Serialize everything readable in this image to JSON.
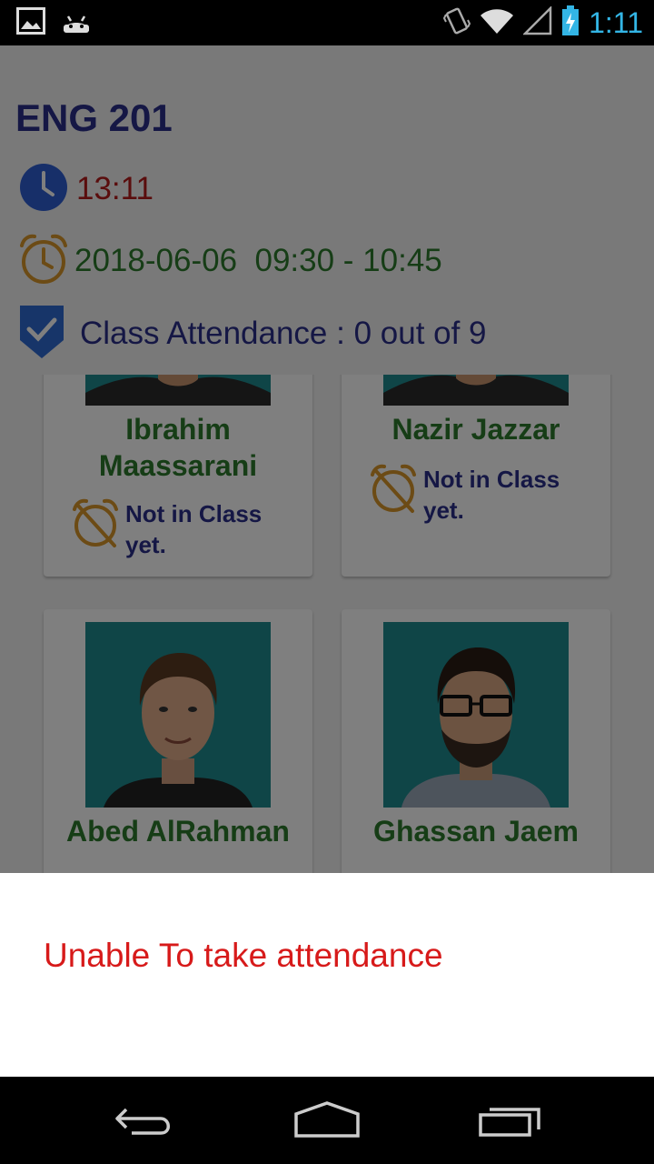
{
  "status_bar": {
    "time": "1:11",
    "icons": [
      "image-notification-icon",
      "android-icon",
      "vibrate-icon",
      "wifi-icon",
      "signal-icon",
      "battery-charging-icon"
    ]
  },
  "course": {
    "title": "ENG 201",
    "current_time": "13:11",
    "schedule": "2018-06-06  09:30 - 10:45",
    "attendance": "Class Attendance : 0 out of 9"
  },
  "students": [
    {
      "name": "Ibrahim Maassarani",
      "status": "Not in Class yet."
    },
    {
      "name": "Nazir Jazzar",
      "status": "Not in Class yet."
    },
    {
      "name": "Abed AlRahman",
      "status": ""
    },
    {
      "name": "Ghassan Jaem",
      "status": ""
    }
  ],
  "message": {
    "text": "Unable To take attendance"
  },
  "colors": {
    "title": "#2a2f8a",
    "name": "#2c7a2c",
    "time": "#b51b1b",
    "error": "#d71a1a",
    "photo_bg": "#1f8a8f"
  }
}
